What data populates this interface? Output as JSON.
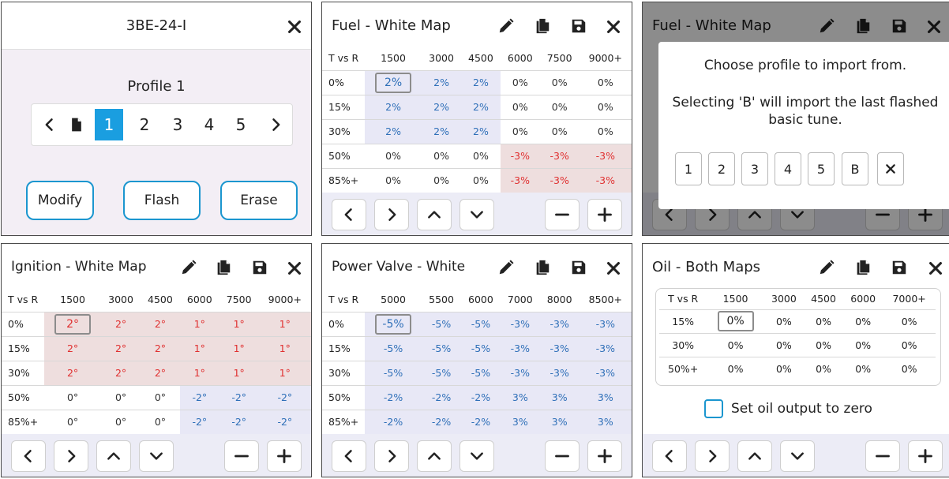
{
  "colors": {
    "accent": "#1a9ee0",
    "button_border": "#1b96cf",
    "positive_value": "#2e6fb8",
    "negative_value": "#e03030",
    "nav_bar": "#ececf6"
  },
  "icons": {
    "edit": "pencil-icon",
    "copy": "copy-icon",
    "save": "save-icon",
    "close": "close-icon"
  },
  "profile_panel": {
    "device_name": "3BE-24-I",
    "profile_label": "Profile 1",
    "profiles": [
      "1",
      "2",
      "3",
      "4",
      "5"
    ],
    "active_profile": "1",
    "buttons": {
      "modify": "Modify",
      "flash": "Flash",
      "erase": "Erase"
    }
  },
  "fuel_map": {
    "title": "Fuel - White Map",
    "columns": [
      "T vs R",
      "1500",
      "3000",
      "4500",
      "6000",
      "7500",
      "9000+"
    ],
    "rows": [
      {
        "label": "0%",
        "cells": [
          "2%",
          "2%",
          "2%",
          "0%",
          "0%",
          "0%"
        ]
      },
      {
        "label": "15%",
        "cells": [
          "2%",
          "2%",
          "2%",
          "0%",
          "0%",
          "0%"
        ]
      },
      {
        "label": "30%",
        "cells": [
          "2%",
          "2%",
          "2%",
          "0%",
          "0%",
          "0%"
        ]
      },
      {
        "label": "50%",
        "cells": [
          "0%",
          "0%",
          "0%",
          "-3%",
          "-3%",
          "-3%"
        ]
      },
      {
        "label": "85%+",
        "cells": [
          "0%",
          "0%",
          "0%",
          "-3%",
          "-3%",
          "-3%"
        ]
      }
    ]
  },
  "import_dialog": {
    "background_title": "Fuel - White Map",
    "line1": "Choose profile to import from.",
    "line2": "Selecting 'B' will import the last flashed basic tune.",
    "options": [
      "1",
      "2",
      "3",
      "4",
      "5",
      "B"
    ]
  },
  "ignition_map": {
    "title": "Ignition - White Map",
    "columns": [
      "T vs R",
      "1500",
      "3000",
      "4500",
      "6000",
      "7500",
      "9000+"
    ],
    "rows": [
      {
        "label": "0%",
        "cells": [
          "2°",
          "2°",
          "2°",
          "1°",
          "1°",
          "1°"
        ]
      },
      {
        "label": "15%",
        "cells": [
          "2°",
          "2°",
          "2°",
          "1°",
          "1°",
          "1°"
        ]
      },
      {
        "label": "30%",
        "cells": [
          "2°",
          "2°",
          "2°",
          "1°",
          "1°",
          "1°"
        ]
      },
      {
        "label": "50%",
        "cells": [
          "0°",
          "0°",
          "0°",
          "-2°",
          "-2°",
          "-2°"
        ]
      },
      {
        "label": "85%+",
        "cells": [
          "0°",
          "0°",
          "0°",
          "-2°",
          "-2°",
          "-2°"
        ]
      }
    ]
  },
  "power_valve_map": {
    "title": "Power Valve - White",
    "columns": [
      "T vs R",
      "5000",
      "5500",
      "6000",
      "7000",
      "8000",
      "8500+"
    ],
    "rows": [
      {
        "label": "0%",
        "cells": [
          "-5%",
          "-5%",
          "-5%",
          "-3%",
          "-3%",
          "-3%"
        ]
      },
      {
        "label": "15%",
        "cells": [
          "-5%",
          "-5%",
          "-5%",
          "-3%",
          "-3%",
          "-3%"
        ]
      },
      {
        "label": "30%",
        "cells": [
          "-5%",
          "-5%",
          "-5%",
          "-3%",
          "-3%",
          "-3%"
        ]
      },
      {
        "label": "50%",
        "cells": [
          "-2%",
          "-2%",
          "-2%",
          "3%",
          "3%",
          "3%"
        ]
      },
      {
        "label": "85%+",
        "cells": [
          "-2%",
          "-2%",
          "-2%",
          "3%",
          "3%",
          "3%"
        ]
      }
    ]
  },
  "oil_map": {
    "title": "Oil - Both Maps",
    "columns": [
      "T vs R",
      "1500",
      "3000",
      "4500",
      "6000",
      "7000+"
    ],
    "rows": [
      {
        "label": "15%",
        "cells": [
          "0%",
          "0%",
          "0%",
          "0%",
          "0%"
        ]
      },
      {
        "label": "30%",
        "cells": [
          "0%",
          "0%",
          "0%",
          "0%",
          "0%"
        ]
      },
      {
        "label": "50%+",
        "cells": [
          "0%",
          "0%",
          "0%",
          "0%",
          "0%"
        ]
      }
    ],
    "checkbox_label": "Set oil output to zero",
    "checkbox_checked": false
  }
}
